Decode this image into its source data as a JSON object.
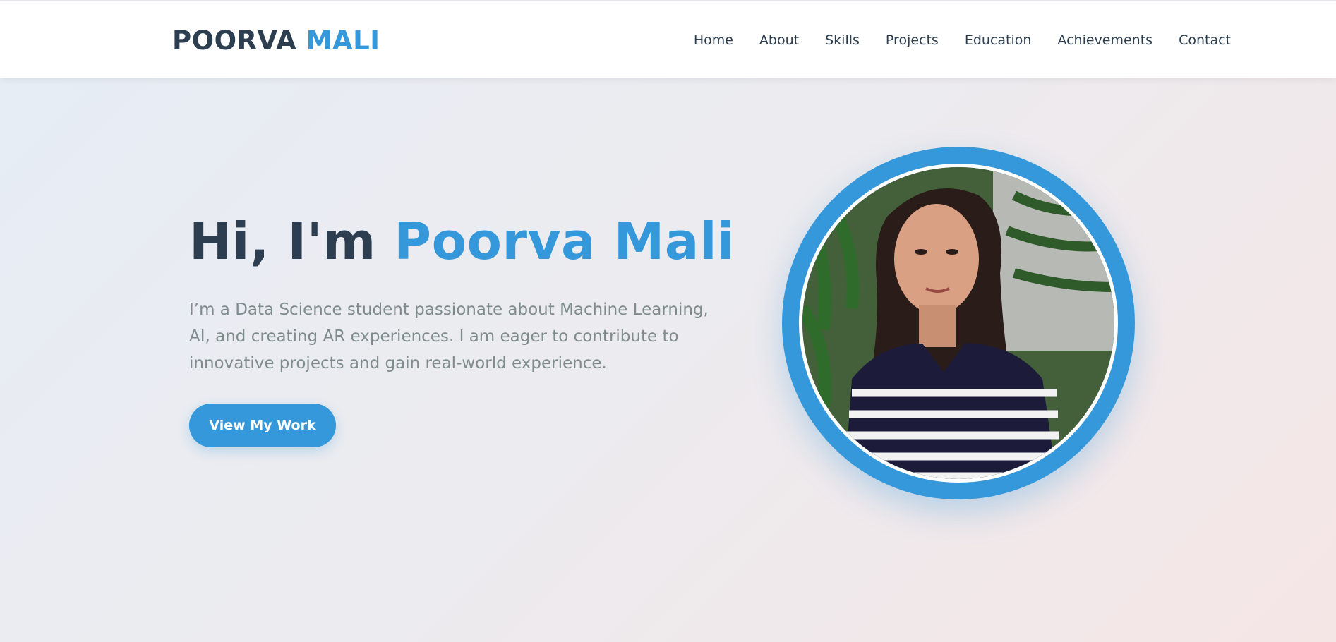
{
  "header": {
    "logo_first": "POORVA",
    "logo_second": "MALI",
    "nav": [
      {
        "label": "Home"
      },
      {
        "label": "About"
      },
      {
        "label": "Skills"
      },
      {
        "label": "Projects"
      },
      {
        "label": "Education"
      },
      {
        "label": "Achievements"
      },
      {
        "label": "Contact"
      }
    ]
  },
  "hero": {
    "greeting": "Hi, I'm",
    "name": "Poorva Mali",
    "description": "I’m a Data Science student passionate about Machine Learning, AI, and creating AR experiences. I am eager to contribute to innovative projects and gain real-world experience.",
    "cta_label": "View My Work"
  },
  "colors": {
    "accent": "#3498db",
    "heading": "#2c3e50",
    "muted_text": "#7f8c8d"
  }
}
